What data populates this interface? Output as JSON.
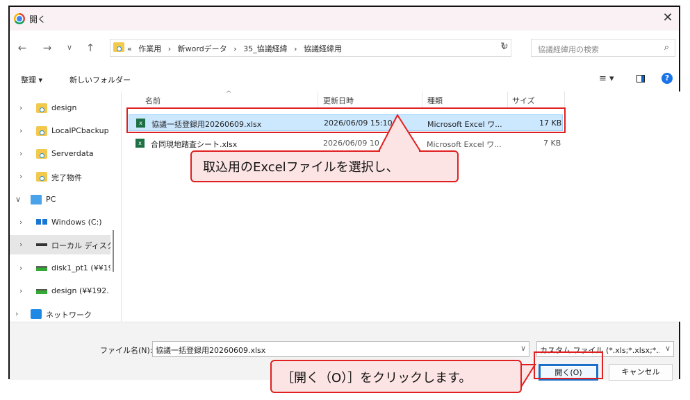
{
  "window": {
    "title": "開く",
    "close_glyph": "✕"
  },
  "nav_buttons": {
    "back": "←",
    "forward": "→",
    "recent": "∨",
    "up": "↑"
  },
  "address": {
    "overflow": "«",
    "crumbs": [
      "作業用",
      "›",
      "新wordデータ",
      "›",
      "35_協議経緯",
      "›",
      "協議経緯用"
    ],
    "dropdown": "∨",
    "refresh": "↻"
  },
  "search": {
    "placeholder": "協議経緯用の検索",
    "icon": "search-icon"
  },
  "toolbar": {
    "organize_label": "整理 ▾",
    "new_folder_label": "新しいフォルダー",
    "view_label": "≡ ▾",
    "help": "?"
  },
  "sidebar": {
    "items": [
      {
        "chevron": "›",
        "label": "design",
        "icon": "folder-icon"
      },
      {
        "chevron": "›",
        "label": "LocalPCbackup",
        "icon": "folder-icon"
      },
      {
        "chevron": "›",
        "label": "Serverdata",
        "icon": "folder-icon"
      },
      {
        "chevron": "›",
        "label": "完了物件",
        "icon": "folder-icon"
      },
      {
        "chevron": "∨",
        "label": "PC",
        "icon": "pc-icon"
      },
      {
        "chevron": "›",
        "label": "Windows (C:)",
        "icon": "windows-drive-icon"
      },
      {
        "chevron": "›",
        "label": "ローカル ディスク",
        "icon": "local-disk-icon"
      },
      {
        "chevron": "›",
        "label": "disk1_pt1 (¥¥19",
        "icon": "network-drive-icon"
      },
      {
        "chevron": "›",
        "label": "design (¥¥192.",
        "icon": "network-drive-icon"
      },
      {
        "chevron": "›",
        "label": "ネットワーク",
        "icon": "network-icon"
      }
    ]
  },
  "table": {
    "columns": [
      "名前",
      "更新日時",
      "種類",
      "サイズ"
    ],
    "sort_indicator": "^",
    "rows": [
      {
        "name": "協議一括登録用20260609.xlsx",
        "modified": "2026/06/09 15:10",
        "type": "Microsoft Excel ワ...",
        "size": "17 KB"
      },
      {
        "name": "合同現地踏査シート.xlsx",
        "modified": "2026/06/09 10",
        "type": "Microsoft Excel ワ...",
        "size": "7 KB"
      }
    ]
  },
  "footer": {
    "filename_label": "ファイル名(N):",
    "filename_value": "協議一括登録用20260609.xlsx",
    "filetype_value": "カスタム ファイル (*.xls;*.xlsx;*.xlsm",
    "dropdown": "∨",
    "open_label": "開く(O)",
    "cancel_label": "キャンセル"
  },
  "callouts": {
    "select_file": "取込用のExcelファイルを選択し、",
    "click_open": "［開く（O）］をクリックします。"
  },
  "colors": {
    "annotation_red": "#e02020",
    "callout_fill": "#fce4e4",
    "selection": "#cce8ff",
    "accent": "#1a6fc9"
  }
}
